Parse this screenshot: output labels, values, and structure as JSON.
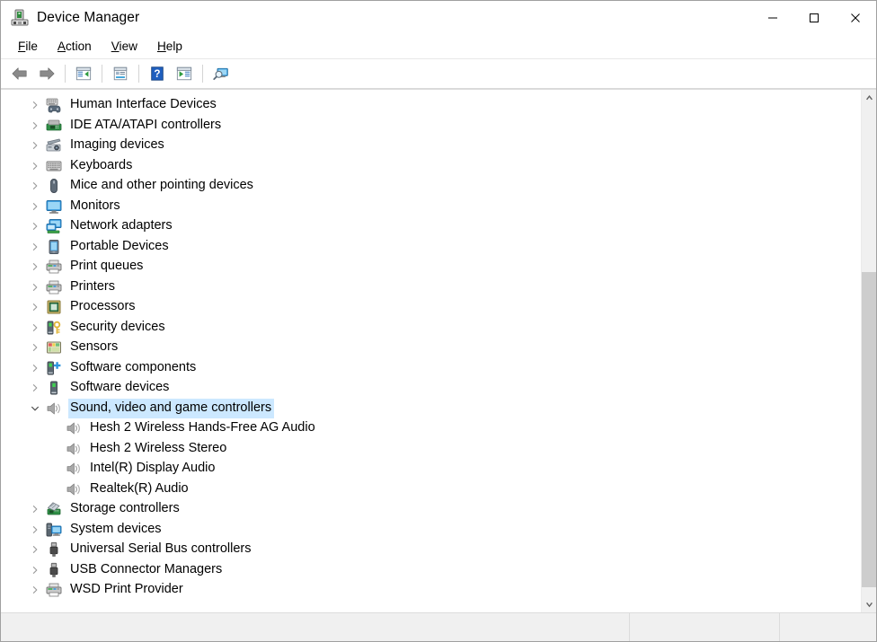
{
  "window": {
    "title": "Device Manager",
    "icon": "device-manager-icon",
    "caption_buttons": [
      {
        "name": "minimize-button",
        "glyph": "—"
      },
      {
        "name": "maximize-button",
        "glyph": "□"
      },
      {
        "name": "close-button",
        "glyph": "✕"
      }
    ]
  },
  "menubar": {
    "items": [
      {
        "label": "File",
        "accel": "F"
      },
      {
        "label": "Action",
        "accel": "A"
      },
      {
        "label": "View",
        "accel": "V"
      },
      {
        "label": "Help",
        "accel": "H"
      }
    ]
  },
  "toolbar": {
    "buttons": [
      {
        "name": "back-button",
        "icon": "back-arrow-icon",
        "label": "Back"
      },
      {
        "name": "forward-button",
        "icon": "forward-arrow-icon",
        "label": "Forward"
      },
      {
        "name": "show-hide-tree-button",
        "icon": "console-tree-icon",
        "label": "Show/Hide Console Tree"
      },
      {
        "name": "properties-button",
        "icon": "properties-icon",
        "label": "Properties"
      },
      {
        "name": "help-button",
        "icon": "help-question-icon",
        "label": "Help"
      },
      {
        "name": "update-driver-button",
        "icon": "update-driver-icon",
        "label": "Update driver"
      },
      {
        "name": "scan-hardware-button",
        "icon": "scan-hardware-icon",
        "label": "Scan for hardware changes"
      }
    ]
  },
  "tree": {
    "selected": "Sound, video and game controllers",
    "highlight_color": "#cce8ff",
    "rows": [
      {
        "label": "Human Interface Devices",
        "icon": "hid-icon",
        "level": 0,
        "expanded": false,
        "selected": false
      },
      {
        "label": "IDE ATA/ATAPI controllers",
        "icon": "ide-controller-icon",
        "level": 0,
        "expanded": false,
        "selected": false
      },
      {
        "label": "Imaging devices",
        "icon": "imaging-device-icon",
        "level": 0,
        "expanded": false,
        "selected": false
      },
      {
        "label": "Keyboards",
        "icon": "keyboard-icon",
        "level": 0,
        "expanded": false,
        "selected": false
      },
      {
        "label": "Mice and other pointing devices",
        "icon": "mouse-icon",
        "level": 0,
        "expanded": false,
        "selected": false
      },
      {
        "label": "Monitors",
        "icon": "monitor-icon",
        "level": 0,
        "expanded": false,
        "selected": false
      },
      {
        "label": "Network adapters",
        "icon": "network-adapter-icon",
        "level": 0,
        "expanded": false,
        "selected": false
      },
      {
        "label": "Portable Devices",
        "icon": "portable-device-icon",
        "level": 0,
        "expanded": false,
        "selected": false
      },
      {
        "label": "Print queues",
        "icon": "printer-icon",
        "level": 0,
        "expanded": false,
        "selected": false
      },
      {
        "label": "Printers",
        "icon": "printer-icon",
        "level": 0,
        "expanded": false,
        "selected": false
      },
      {
        "label": "Processors",
        "icon": "processor-icon",
        "level": 0,
        "expanded": false,
        "selected": false
      },
      {
        "label": "Security devices",
        "icon": "security-device-icon",
        "level": 0,
        "expanded": false,
        "selected": false
      },
      {
        "label": "Sensors",
        "icon": "sensor-icon",
        "level": 0,
        "expanded": false,
        "selected": false
      },
      {
        "label": "Software components",
        "icon": "software-component-icon",
        "level": 0,
        "expanded": false,
        "selected": false
      },
      {
        "label": "Software devices",
        "icon": "software-device-icon",
        "level": 0,
        "expanded": false,
        "selected": false
      },
      {
        "label": "Sound, video and game controllers",
        "icon": "speaker-icon",
        "level": 0,
        "expanded": true,
        "selected": true
      },
      {
        "label": "Hesh 2 Wireless Hands-Free AG Audio",
        "icon": "speaker-icon",
        "level": 1,
        "expanded": false,
        "selected": false
      },
      {
        "label": "Hesh 2 Wireless Stereo",
        "icon": "speaker-icon",
        "level": 1,
        "expanded": false,
        "selected": false
      },
      {
        "label": "Intel(R) Display Audio",
        "icon": "speaker-icon",
        "level": 1,
        "expanded": false,
        "selected": false
      },
      {
        "label": "Realtek(R) Audio",
        "icon": "speaker-icon",
        "level": 1,
        "expanded": false,
        "selected": false
      },
      {
        "label": "Storage controllers",
        "icon": "storage-controller-icon",
        "level": 0,
        "expanded": false,
        "selected": false
      },
      {
        "label": "System devices",
        "icon": "system-device-icon",
        "level": 0,
        "expanded": false,
        "selected": false
      },
      {
        "label": "Universal Serial Bus controllers",
        "icon": "usb-icon",
        "level": 0,
        "expanded": false,
        "selected": false
      },
      {
        "label": "USB Connector Managers",
        "icon": "usb-icon",
        "level": 0,
        "expanded": false,
        "selected": false
      },
      {
        "label": "WSD Print Provider",
        "icon": "printer-icon",
        "level": 0,
        "expanded": false,
        "selected": false
      }
    ]
  },
  "scrollbar": {
    "name": "vertical-scrollbar",
    "up_arrow": "˄",
    "down_arrow": "˅",
    "thumb_top_pct": 34,
    "thumb_height_pct": 64
  },
  "statusbar": {
    "panes": [
      {
        "text": ""
      },
      {
        "text": ""
      },
      {
        "text": ""
      }
    ]
  }
}
